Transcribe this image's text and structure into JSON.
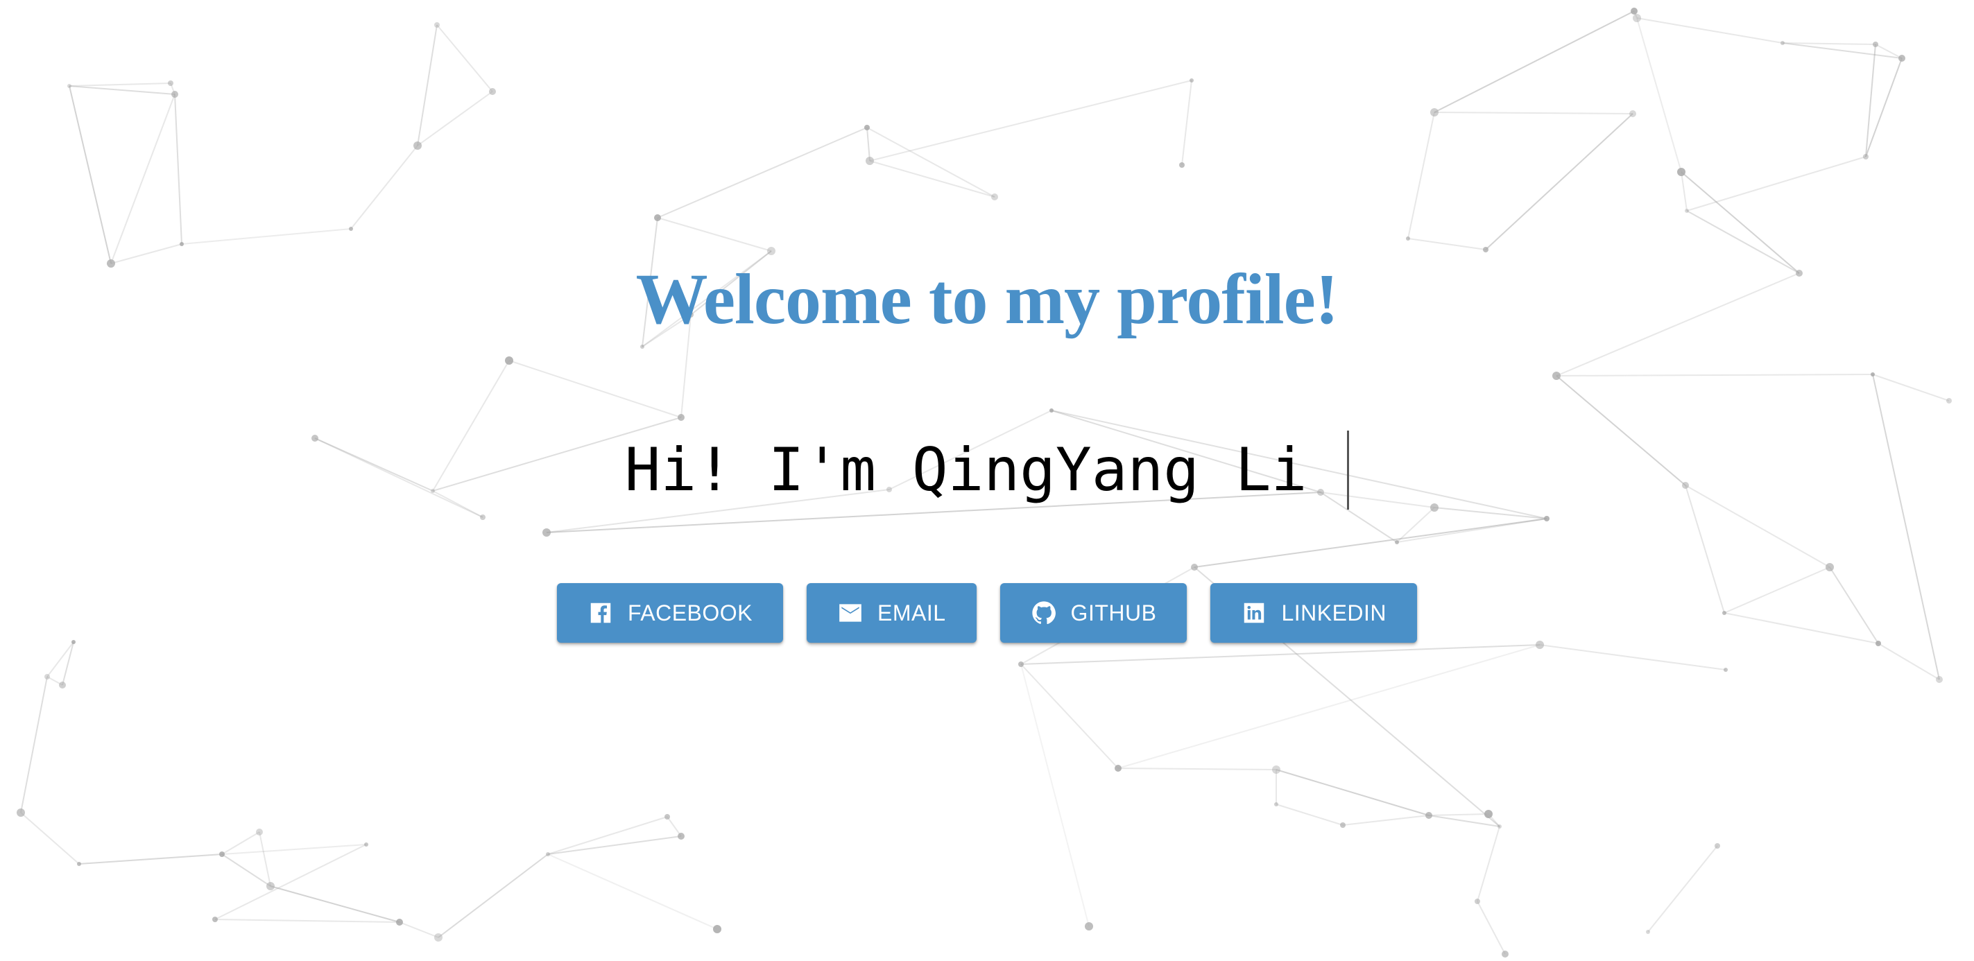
{
  "hero": {
    "title": "Welcome to my profile!",
    "typed_text": "Hi! I'm QingYang Li"
  },
  "buttons": [
    {
      "label": "FACEBOOK",
      "icon": "facebook-icon"
    },
    {
      "label": "EMAIL",
      "icon": "email-icon"
    },
    {
      "label": "GITHUB",
      "icon": "github-icon"
    },
    {
      "label": "LINKEDIN",
      "icon": "linkedin-icon"
    }
  ],
  "colors": {
    "accent": "#4a90c8",
    "background": "#ffffff",
    "text": "#000000",
    "network": "#9a9a9a"
  }
}
